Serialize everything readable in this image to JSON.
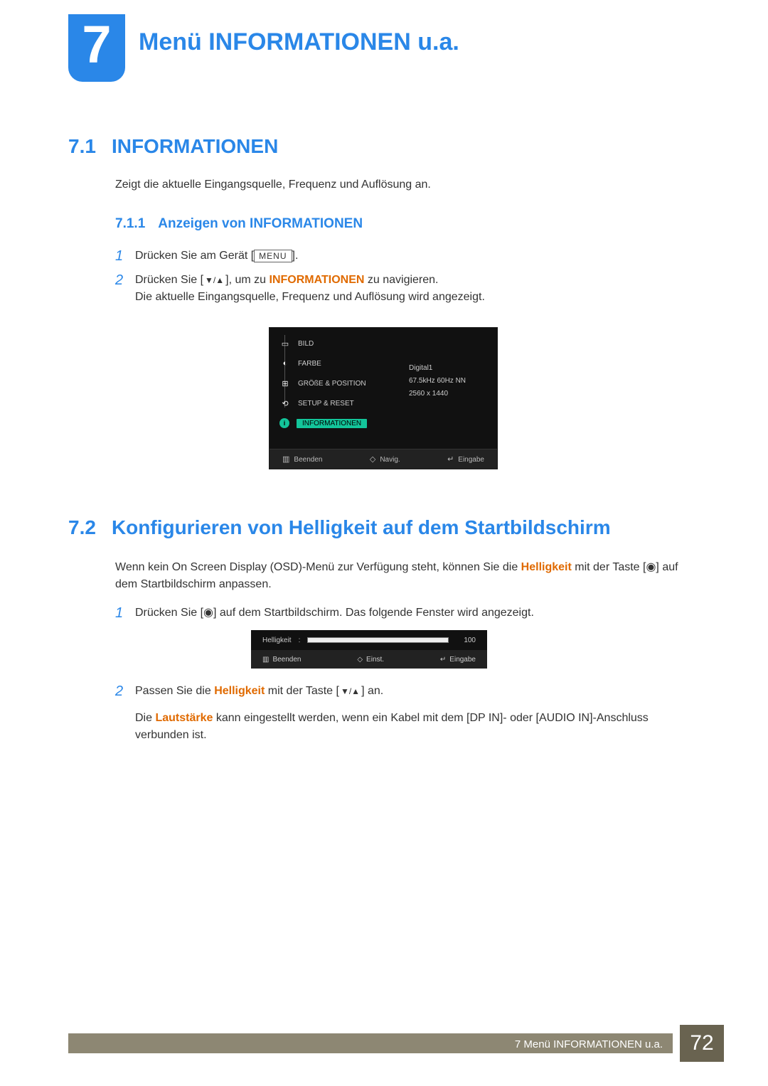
{
  "chapter": {
    "number": "7",
    "title": "Menü INFORMATIONEN u.a."
  },
  "s71": {
    "num": "7.1",
    "title": "INFORMATIONEN",
    "intro": "Zeigt die aktuelle Eingangsquelle, Frequenz und Auflösung an."
  },
  "s711": {
    "num": "7.1.1",
    "title": "Anzeigen von INFORMATIONEN",
    "step1_num": "1",
    "step1_a": "Drücken Sie am Gerät [",
    "step1_menu": "MENU",
    "step1_b": "].",
    "step2_num": "2",
    "step2_a": "Drücken Sie [",
    "step2_arrows": "▼/▲",
    "step2_b": "], um zu ",
    "step2_em": "INFORMATIONEN",
    "step2_c": " zu navigieren.",
    "step2_line2": "Die aktuelle Eingangsquelle, Frequenz und Auflösung wird angezeigt."
  },
  "osd1": {
    "items": {
      "bild": "BILD",
      "farbe": "FARBE",
      "groesse": "GRÖßE & POSITION",
      "setup": "SETUP & RESET",
      "info": "INFORMATIONEN"
    },
    "info_lines": {
      "a": "Digital1",
      "b": "67.5kHz 60Hz NN",
      "c": "2560 x 1440"
    },
    "footer": {
      "exit": "Beenden",
      "nav": "Navig.",
      "enter": "Eingabe"
    }
  },
  "s72": {
    "num": "7.2",
    "title": "Konfigurieren von Helligkeit auf dem Startbildschirm",
    "para_a": "Wenn kein On Screen Display (OSD)-Menü zur Verfügung steht, können Sie die ",
    "para_em": "Helligkeit",
    "para_b": " mit der Taste [",
    "para_btn": "◉",
    "para_c": "] auf dem Startbildschirm anpassen.",
    "step1_num": "1",
    "step1_a": "Drücken Sie [",
    "step1_btn": "◉",
    "step1_b": "] auf dem Startbildschirm. Das folgende Fenster wird angezeigt.",
    "step2_num": "2",
    "step2_a": "Passen Sie die ",
    "step2_em": "Helligkeit",
    "step2_b": " mit der Taste [",
    "step2_arrows": "▼/▲",
    "step2_c": "] an.",
    "note_a": "Die ",
    "note_em": "Lautstärke",
    "note_b": " kann eingestellt werden, wenn ein Kabel mit dem [DP IN]- oder [AUDIO IN]-Anschluss verbunden ist."
  },
  "osd2": {
    "label": "Helligkeit",
    "colon": ":",
    "value": "100",
    "footer": {
      "exit": "Beenden",
      "adjust": "Einst.",
      "enter": "Eingabe"
    }
  },
  "footer": {
    "text": "7 Menü INFORMATIONEN u.a.",
    "page": "72"
  }
}
